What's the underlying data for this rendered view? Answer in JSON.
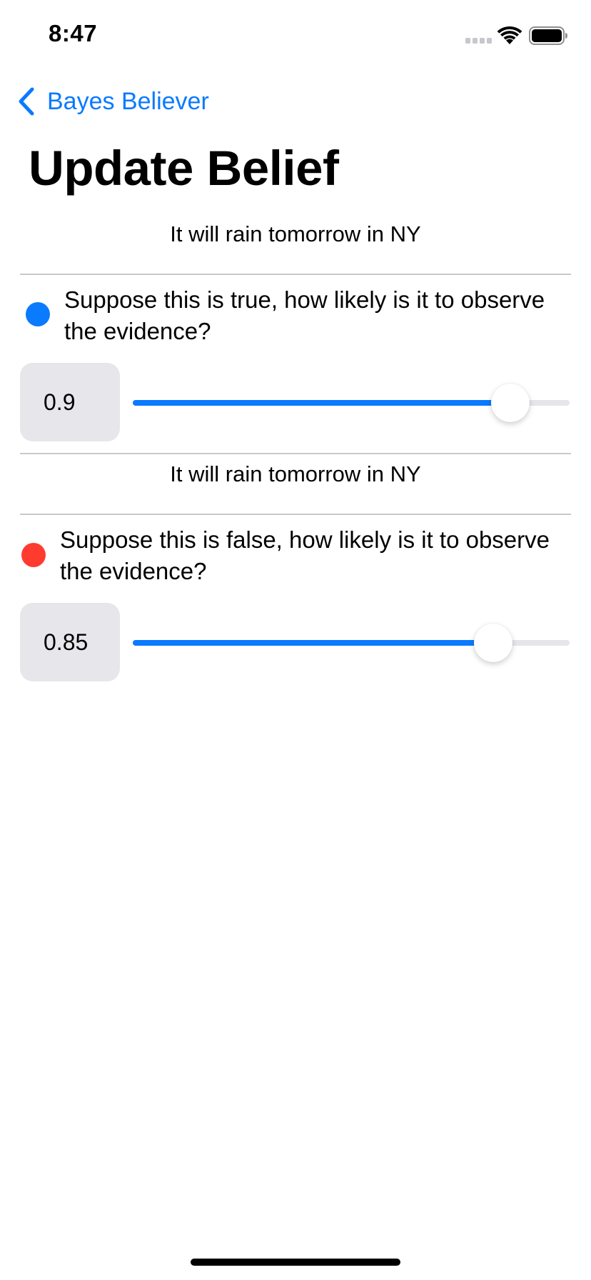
{
  "status_bar": {
    "time": "8:47"
  },
  "nav": {
    "back_label": "Bayes Believer",
    "title": "Update Belief"
  },
  "accent_color": "#0a7aff",
  "sections": [
    {
      "statement": "It will rain tomorrow in NY",
      "dot_color": "#0a7aff",
      "question": "Suppose this is true, how likely is it to observe the evidence?",
      "value": "0.9",
      "slider_value": 0.9
    },
    {
      "statement": "It will rain tomorrow in NY",
      "dot_color": "#ff3b30",
      "question": "Suppose this is false, how likely is it to observe the evidence?",
      "value": "0.85",
      "slider_value": 0.85
    }
  ]
}
